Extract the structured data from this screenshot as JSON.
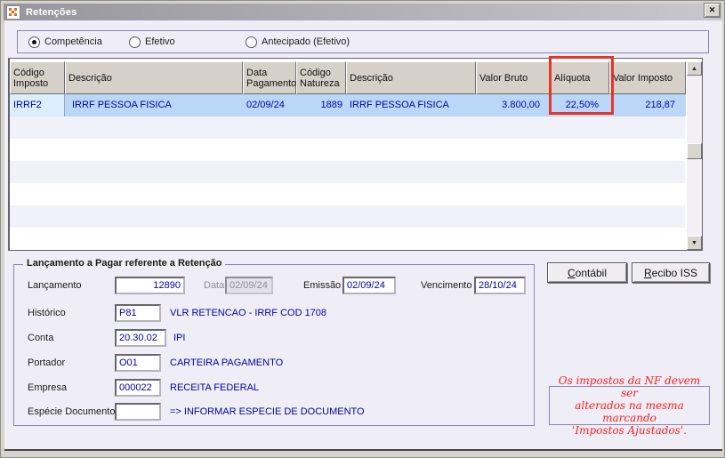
{
  "window": {
    "title": "Retenções"
  },
  "icons": {
    "close": "✕",
    "scroll_up": "▲",
    "scroll_down": "▼"
  },
  "modes": {
    "selected": "Competência",
    "options": [
      {
        "label": "Competência"
      },
      {
        "label": "Efetivo"
      },
      {
        "label": "Antecipado (Efetivo)"
      }
    ]
  },
  "grid": {
    "columns": [
      "Código Imposto",
      "Descrição",
      "Data Pagamento",
      "Código Natureza",
      "Descrição",
      "Valor Bruto",
      "Alíquota",
      "Valor Imposto"
    ],
    "rows": [
      [
        "IRRF2",
        "IRRF PESSOA FISICA",
        "02/09/24",
        "1889",
        "IRRF PESSOA FISICA",
        "3.800,00",
        "22,50%",
        "218,87"
      ]
    ],
    "highlighted_column": "Alíquota"
  },
  "detail": {
    "title": "Lançamento a Pagar referente a Retenção",
    "lancamento": {
      "label": "Lançamento",
      "value": "12890"
    },
    "data": {
      "label": "Data",
      "value": "02/09/24"
    },
    "emissao": {
      "label": "Emissão",
      "value": "02/09/24"
    },
    "vencimento": {
      "label": "Vencimento",
      "value": "28/10/24"
    },
    "historico": {
      "label": "Histórico",
      "code": "P81",
      "desc": "VLR RETENCAO - IRRF COD 1708"
    },
    "conta": {
      "label": "Conta",
      "code": "20.30.02",
      "desc": "IPI"
    },
    "portador": {
      "label": "Portador",
      "code": "O01",
      "desc": "CARTEIRA PAGAMENTO"
    },
    "empresa": {
      "label": "Empresa",
      "code": "000022",
      "desc": "RECEITA FEDERAL"
    },
    "especie": {
      "label": "Espécie Documento",
      "code": "",
      "desc": "=> INFORMAR ESPECIE DE DOCUMENTO"
    }
  },
  "buttons": {
    "contabil": {
      "accel": "C",
      "rest": "ontábil"
    },
    "recibo": {
      "accel": "R",
      "rest": "ecibo ISS"
    }
  },
  "note": {
    "lines": [
      "Os impostos da NF devem ser",
      "alterados na mesma marcando",
      "'Impostos Ajustados'."
    ]
  },
  "colors": {
    "selection_row": "#BAD7F8",
    "highlight_box": "#E5352B",
    "value_text": "#0202A8",
    "note_text": "#FF2020",
    "header_bg": "#D5D1C8"
  }
}
